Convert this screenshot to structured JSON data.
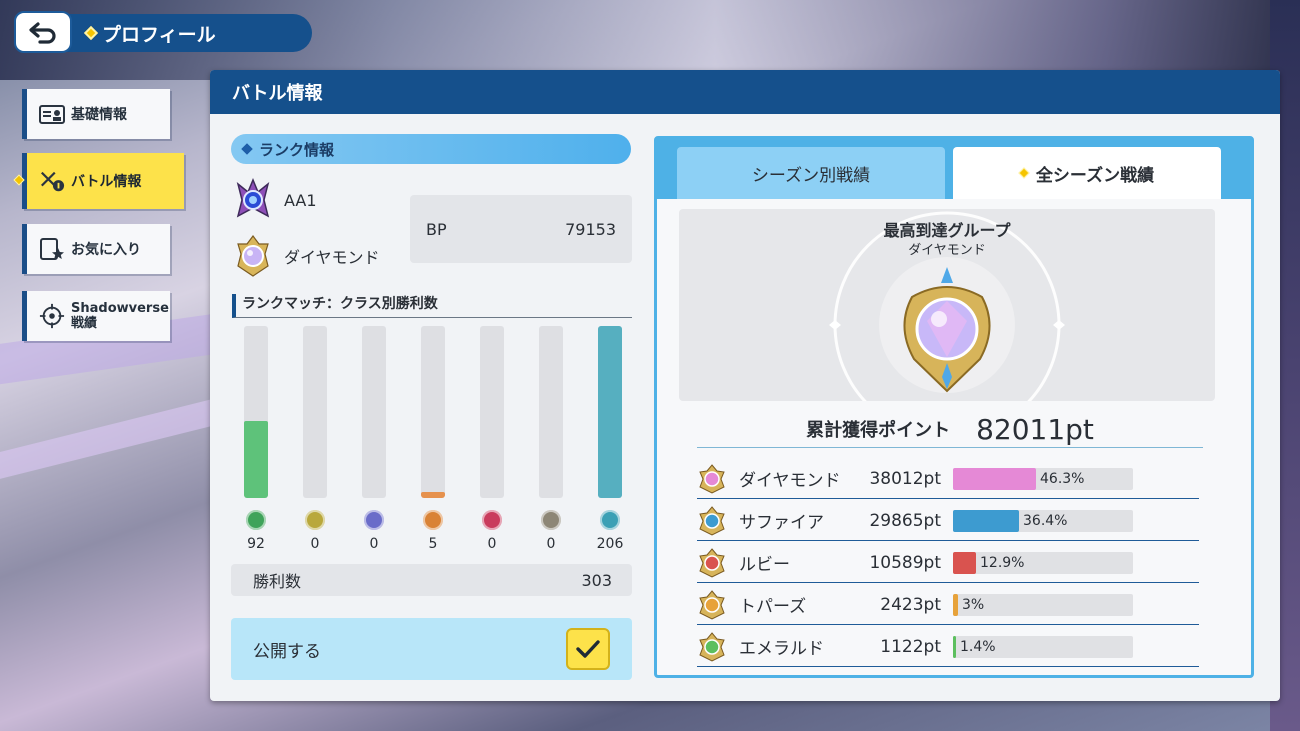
{
  "header": {
    "title": "プロフィール"
  },
  "sidebar": {
    "items": [
      {
        "label": "基礎情報",
        "icon": "id-card-icon"
      },
      {
        "label": "バトル情報",
        "icon": "crossed-swords-icon"
      },
      {
        "label": "お気に入り",
        "icon": "favorite-card-icon"
      },
      {
        "label_line1": "Shadowverse",
        "label_line2": "戦績",
        "icon": "target-crest-icon"
      }
    ]
  },
  "panel": {
    "title": "バトル情報",
    "rank": {
      "section_label": "ランク情報",
      "rank_name": "AA1",
      "group_name": "ダイヤモンド",
      "bp_label": "BP",
      "bp_value": "79153"
    },
    "class_wins": {
      "title": "ランクマッチ：クラス別勝利数",
      "max": 206,
      "classes": [
        {
          "icon": "forest-leaf-icon",
          "wins": "92",
          "value": 92,
          "color": "#5ec27a",
          "icon_color": "#3fa35a"
        },
        {
          "icon": "sword-crown-icon",
          "wins": "0",
          "value": 0,
          "color": "#c7b54a",
          "icon_color": "#b9a83c"
        },
        {
          "icon": "rune-circle-icon",
          "wins": "0",
          "value": 0,
          "color": "#6a6cc9",
          "icon_color": "#6a6cc9"
        },
        {
          "icon": "dragon-icon",
          "wins": "5",
          "value": 5,
          "color": "#e6914d",
          "icon_color": "#d98236"
        },
        {
          "icon": "blood-rose-icon",
          "wins": "0",
          "value": 0,
          "color": "#d9446a",
          "icon_color": "#c93b5d"
        },
        {
          "icon": "haven-icon",
          "wins": "0",
          "value": 0,
          "color": "#9a9282",
          "icon_color": "#8d8676"
        },
        {
          "icon": "portal-icon",
          "wins": "206",
          "value": 206,
          "color": "#56afc0",
          "icon_color": "#3ba0b5"
        }
      ]
    },
    "wins": {
      "label": "勝利数",
      "value": "303"
    },
    "public": {
      "label": "公開する",
      "checked": true
    },
    "tabs": {
      "season": "シーズン別戦績",
      "all": "全シーズン戦績"
    },
    "best_group": {
      "title": "最高到達グループ",
      "name": "ダイヤモンド"
    },
    "total": {
      "label": "累計獲得ポイント",
      "value": "82011pt"
    },
    "groups": [
      {
        "name": "ダイヤモンド",
        "points": "38012pt",
        "percent_label": "46.3%",
        "percent": 46.3,
        "color": "#e589d6",
        "icon": "diamond-emblem-icon"
      },
      {
        "name": "サファイア",
        "points": "29865pt",
        "percent_label": "36.4%",
        "percent": 36.4,
        "color": "#3d9bd0",
        "icon": "sapphire-emblem-icon"
      },
      {
        "name": "ルビー",
        "points": "10589pt",
        "percent_label": "12.9%",
        "percent": 12.9,
        "color": "#d9534f",
        "icon": "ruby-emblem-icon"
      },
      {
        "name": "トパーズ",
        "points": "2423pt",
        "percent_label": "3%",
        "percent": 3,
        "color": "#e7a23a",
        "icon": "topaz-emblem-icon"
      },
      {
        "name": "エメラルド",
        "points": "1122pt",
        "percent_label": "1.4%",
        "percent": 1.4,
        "color": "#5cbf5e",
        "icon": "emerald-emblem-icon"
      }
    ]
  }
}
